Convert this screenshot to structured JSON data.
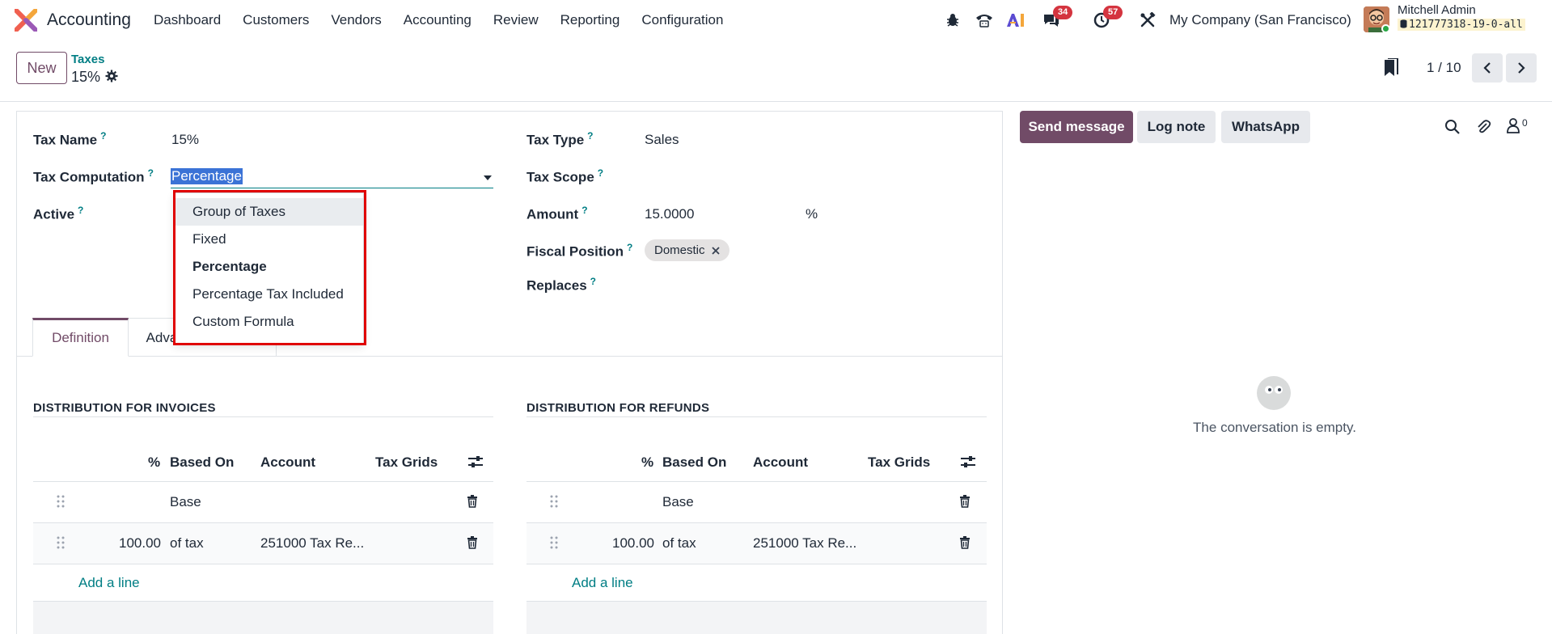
{
  "navbar": {
    "app_name": "Accounting",
    "menu": [
      "Dashboard",
      "Customers",
      "Vendors",
      "Accounting",
      "Review",
      "Reporting",
      "Configuration"
    ],
    "messages_badge": "34",
    "activities_badge": "57",
    "company": "My Company (San Francisco)",
    "user_name": "Mitchell Admin",
    "database": "121777318-19-0-all"
  },
  "control_panel": {
    "new_label": "New",
    "breadcrumb_parent": "Taxes",
    "breadcrumb_current": "15%",
    "pager": "1 / 10"
  },
  "form": {
    "tax_name_label": "Tax Name",
    "tax_name_value": "15%",
    "tax_computation_label": "Tax Computation",
    "tax_computation_value": "Percentage",
    "active_label": "Active",
    "tax_type_label": "Tax Type",
    "tax_type_value": "Sales",
    "tax_scope_label": "Tax Scope",
    "amount_label": "Amount",
    "amount_value": "15.0000",
    "amount_unit": "%",
    "fiscal_position_label": "Fiscal Position",
    "fiscal_position_tag": "Domestic",
    "replaces_label": "Replaces",
    "help_mark": "?"
  },
  "dropdown": {
    "options": [
      "Group of Taxes",
      "Fixed",
      "Percentage",
      "Percentage Tax Included",
      "Custom Formula"
    ],
    "selected": "Percentage",
    "hovered": "Group of Taxes"
  },
  "tabs": {
    "definition": "Definition",
    "advanced": "Advanced Options"
  },
  "invoices": {
    "title": "DISTRIBUTION FOR INVOICES",
    "headers": [
      "%",
      "Based On",
      "Account",
      "Tax Grids"
    ],
    "rows": [
      {
        "percent": "",
        "based_on": "Base",
        "account": ""
      },
      {
        "percent": "100.00",
        "based_on": "of tax",
        "account": "251000 Tax Re..."
      }
    ],
    "add_line": "Add a line"
  },
  "refunds": {
    "title": "DISTRIBUTION FOR REFUNDS",
    "headers": [
      "%",
      "Based On",
      "Account",
      "Tax Grids"
    ],
    "rows": [
      {
        "percent": "",
        "based_on": "Base",
        "account": ""
      },
      {
        "percent": "100.00",
        "based_on": "of tax",
        "account": "251000 Tax Re..."
      }
    ],
    "add_line": "Add a line"
  },
  "chatter": {
    "send_message": "Send message",
    "log_note": "Log note",
    "whatsapp": "WhatsApp",
    "followers_count": "0",
    "empty_text": "The conversation is empty."
  },
  "colors": {
    "brand": "#714b67",
    "link": "#017e84",
    "highlight": "#e00000"
  }
}
